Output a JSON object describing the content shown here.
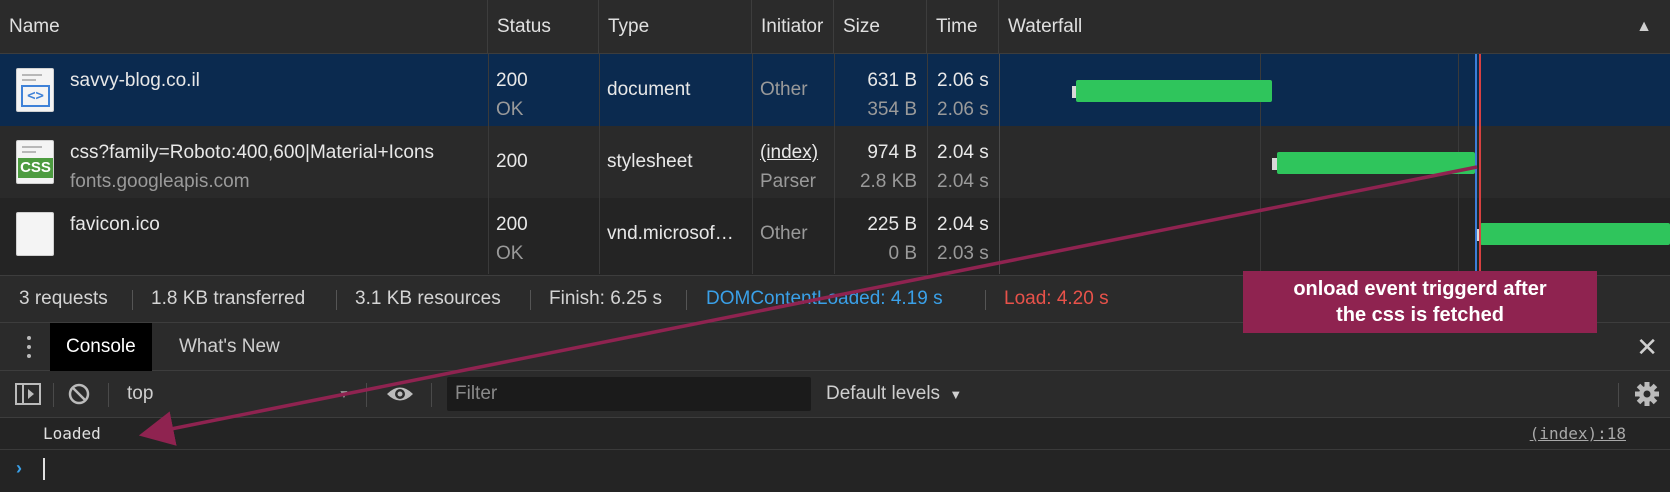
{
  "columns": {
    "name": "Name",
    "status": "Status",
    "type": "Type",
    "initiator": "Initiator",
    "size": "Size",
    "time": "Time",
    "waterfall": "Waterfall",
    "sort_arrow": "▲"
  },
  "rows": [
    {
      "name": "savvy-blog.co.il",
      "domain": "",
      "status_code": "200",
      "status_text": "OK",
      "type": "document",
      "initiator": "Other",
      "initiator_sub": "",
      "size_transferred": "631 B",
      "size_resource": "354 B",
      "time_total": "2.06 s",
      "time_latency": "2.06 s",
      "icon": "html-file-icon"
    },
    {
      "name": "css?family=Roboto:400,600|Material+Icons",
      "domain": "fonts.googleapis.com",
      "status_code": "200",
      "status_text": "",
      "type": "stylesheet",
      "initiator": "(index)",
      "initiator_sub": "Parser",
      "size_transferred": "974 B",
      "size_resource": "2.8 KB",
      "time_total": "2.04 s",
      "time_latency": "2.04 s",
      "icon": "css-file-icon",
      "badge": "CSS"
    },
    {
      "name": "favicon.ico",
      "domain": "",
      "status_code": "200",
      "status_text": "OK",
      "type": "vnd.microsof…",
      "initiator": "Other",
      "initiator_sub": "",
      "size_transferred": "225 B",
      "size_resource": "0 B",
      "time_total": "2.04 s",
      "time_latency": "2.03 s",
      "icon": "blank-file-icon"
    }
  ],
  "summary": {
    "requests": "3 requests",
    "transferred": "1.8 KB transferred",
    "resources": "3.1 KB resources",
    "finish": "Finish: 6.25 s",
    "dom_content_loaded": "DOMContentLoaded: 4.19 s",
    "load": "Load: 4.20 s"
  },
  "drawer": {
    "tabs": [
      {
        "label": "Console",
        "active": true
      },
      {
        "label": "What's New",
        "active": false
      }
    ],
    "close_icon": "close-icon"
  },
  "console_toolbar": {
    "context": "top",
    "filter_placeholder": "Filter",
    "levels": "Default levels"
  },
  "console": {
    "messages": [
      {
        "text": "Loaded",
        "source": "(index):18"
      }
    ],
    "prompt": "›"
  },
  "annotation": {
    "line1": "onload event triggerd after",
    "line2": "the css is fetched"
  },
  "colors": {
    "selected_row": "#0b2a4f",
    "bar_green": "#2fc55c",
    "dcl_blue": "#3aa0e8",
    "load_red": "#e8524a",
    "callout": "#8f2350"
  }
}
